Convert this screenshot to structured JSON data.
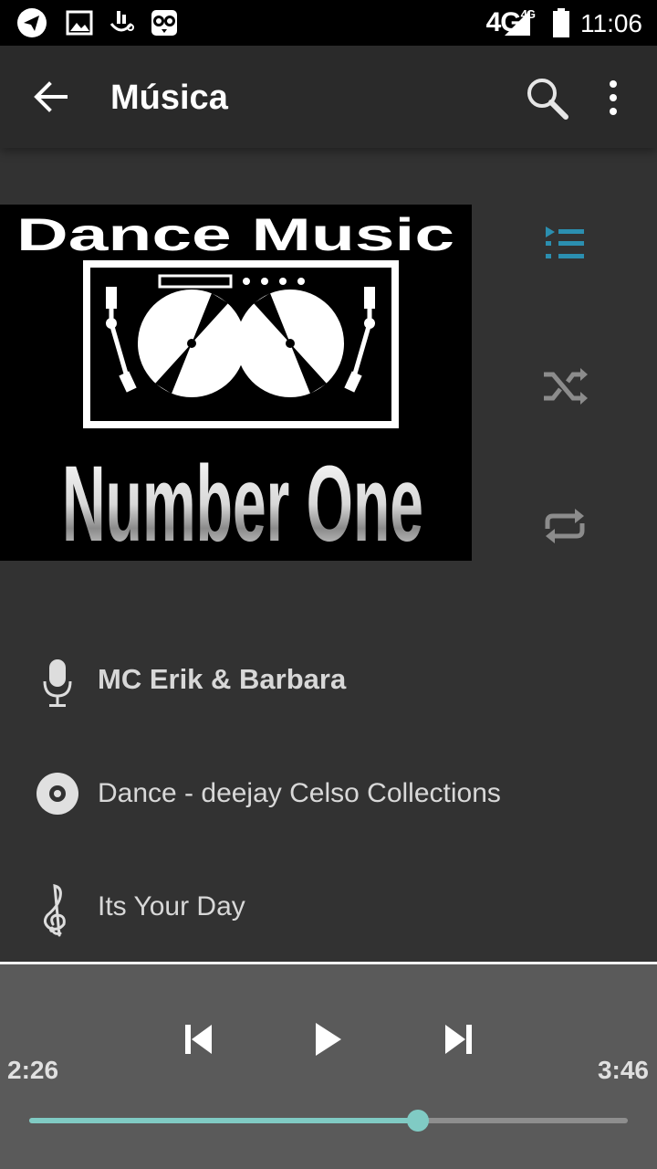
{
  "status_bar": {
    "network": "4G",
    "network_small": "4G",
    "time": "11:06",
    "icons": [
      "telegram-icon",
      "gallery-icon",
      "touchpal-icon",
      "owl-icon",
      "signal-icon",
      "battery-icon"
    ]
  },
  "toolbar": {
    "title": "Música",
    "back_icon": "arrow-back-icon",
    "search_icon": "search-icon",
    "more_icon": "more-vert-icon"
  },
  "album_art": {
    "line1": "Dance Music",
    "line2": "Number One"
  },
  "side_controls": {
    "queue_icon": "queue-list-icon",
    "shuffle_icon": "shuffle-icon",
    "repeat_icon": "repeat-icon",
    "accent": "#2b8fb0",
    "inactive": "#8c8c8c"
  },
  "track_info": {
    "artist": "MC Erik & Barbara",
    "album": "Dance - deejay Celso Collections",
    "title": "Its Your Day"
  },
  "player": {
    "elapsed": "2:26",
    "duration": "3:46",
    "progress": 0.65,
    "accent": "#80cbc4"
  }
}
